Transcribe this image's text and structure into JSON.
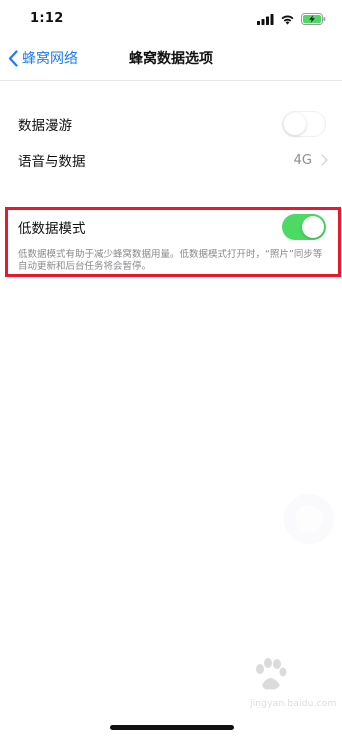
{
  "status_bar": {
    "time": "1:12",
    "signal_icon": "cellular-signal-icon",
    "wifi_icon": "wifi-icon",
    "battery_icon": "battery-charging-icon",
    "battery_color": "#4cd964"
  },
  "nav": {
    "back_label": "蜂窝网络",
    "title": "蜂窝数据选项",
    "accent_color": "#1e7cf2"
  },
  "group1": {
    "roaming_label": "数据漫游",
    "roaming_on": false,
    "voice_label": "语音与数据",
    "voice_value": "4G"
  },
  "group2": {
    "low_data_label": "低数据模式",
    "low_data_on": true,
    "footnote": "低数据模式有助于减少蜂窝数据用量。低数据模式打开时，“照片”同步等自动更新和后台任务将会暂停。",
    "toggle_color": "#4cd964"
  },
  "highlight_color": "#e8192c",
  "watermark": {
    "text": "jingyan.baidu.com",
    "brand": "Baidu 经验"
  }
}
